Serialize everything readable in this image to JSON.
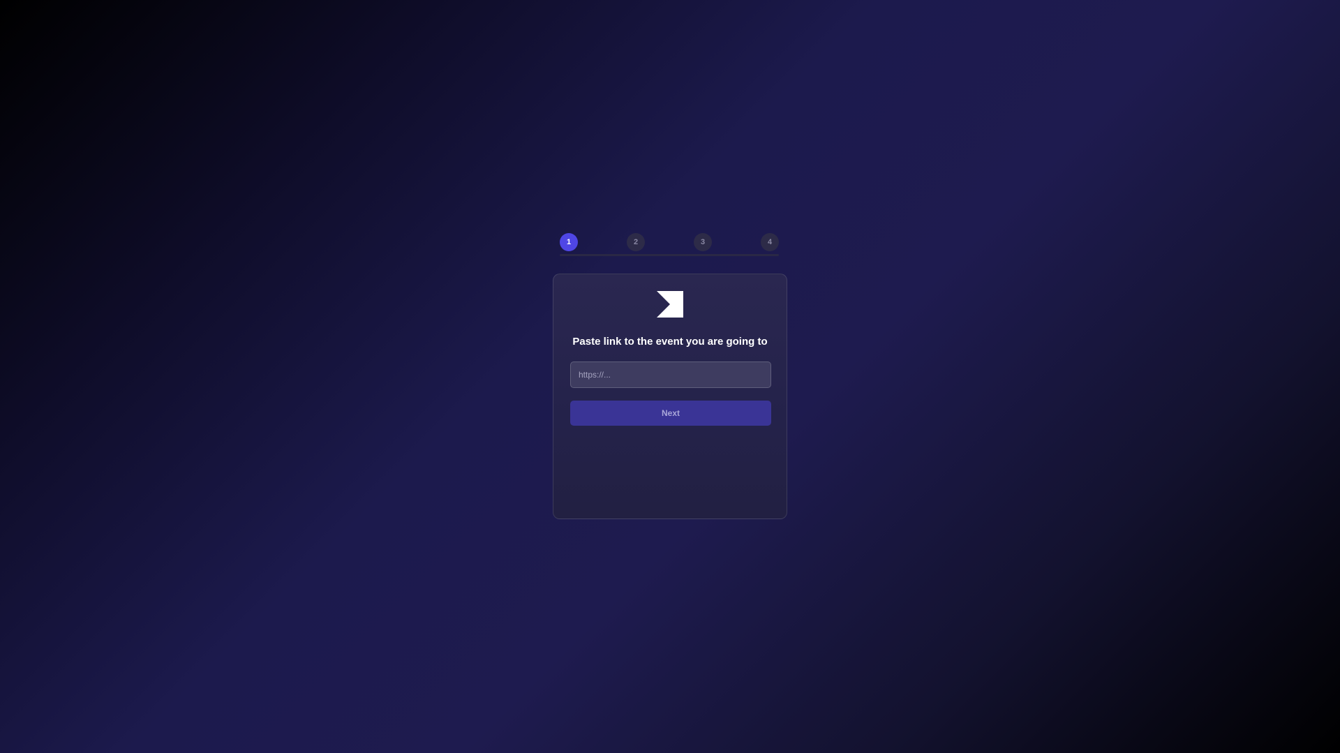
{
  "stepper": {
    "steps": [
      {
        "label": "1",
        "active": true
      },
      {
        "label": "2",
        "active": false
      },
      {
        "label": "3",
        "active": false
      },
      {
        "label": "4",
        "active": false
      }
    ],
    "current_step": 1,
    "total_steps": 4
  },
  "card": {
    "logo_icon": "flag-arrow-icon",
    "title": "Paste link to the event you are going to",
    "url_input": {
      "value": "",
      "placeholder": "https://..."
    },
    "next_label": "Next"
  },
  "colors": {
    "accent": "#4f46e5",
    "button": "#3a3496",
    "step_inactive": "#2d2b48",
    "card_background": "#26244c"
  }
}
